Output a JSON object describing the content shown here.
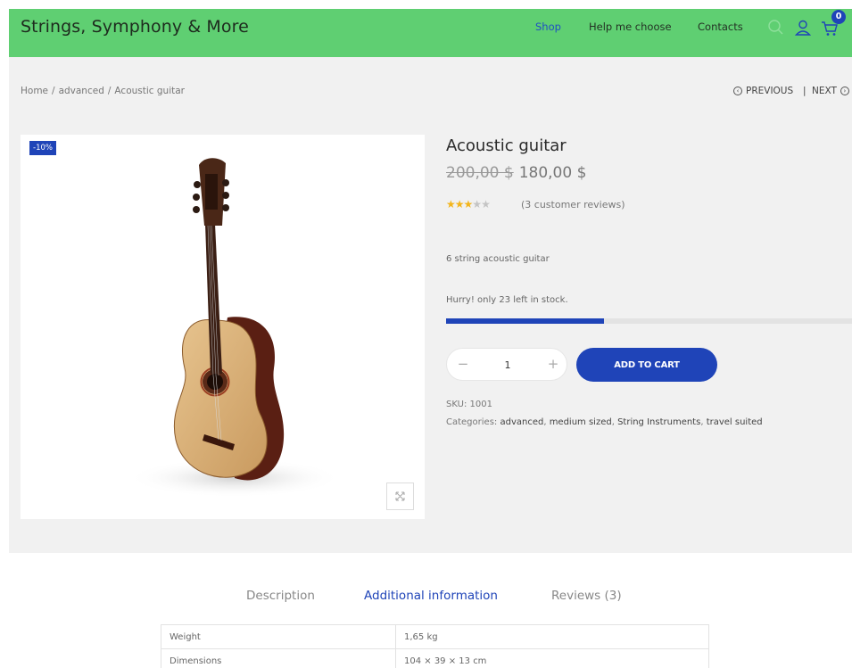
{
  "header": {
    "brand": "Strings, Symphony & More",
    "nav": [
      "Shop",
      "Help me choose",
      "Contacts"
    ],
    "cart_count": "0"
  },
  "breadcrumb": {
    "home": "Home",
    "category": "advanced",
    "current": "Acoustic guitar",
    "separator": "/"
  },
  "pager": {
    "previous": "PREVIOUS",
    "next": "NEXT",
    "separator": "|"
  },
  "product": {
    "badge": "-10%",
    "title": "Acoustic guitar",
    "old_price": "200,00 $",
    "price": "180,00 $",
    "rating": 3,
    "rating_max": 5,
    "reviews_link": "(3 customer reviews)",
    "short_description": "6 string  acoustic guitar",
    "stock_text": "Hurry! only 23 left in stock.",
    "stock_fraction": 0.39,
    "quantity": "1",
    "add_to_cart": "ADD TO CART",
    "sku_label": "SKU:",
    "sku": "1001",
    "categories_label": "Categories:",
    "categories": [
      "advanced",
      "medium sized",
      "String Instruments",
      "travel suited"
    ]
  },
  "tabs": [
    "Description",
    "Additional information",
    "Reviews (3)"
  ],
  "active_tab": 1,
  "attributes": [
    {
      "label": "Weight",
      "value": "1,65 kg"
    },
    {
      "label": "Dimensions",
      "value": "104 × 39 × 13 cm"
    }
  ],
  "colors": {
    "header_bg": "#5fcf72",
    "accent": "#1f44b8",
    "star": "#f3b51b",
    "band_bg": "#f1f1f1"
  },
  "icons": [
    "search-icon",
    "user-icon",
    "cart-icon",
    "chevron-left-icon",
    "chevron-right-icon",
    "expand-icon",
    "minus-icon",
    "plus-icon"
  ]
}
